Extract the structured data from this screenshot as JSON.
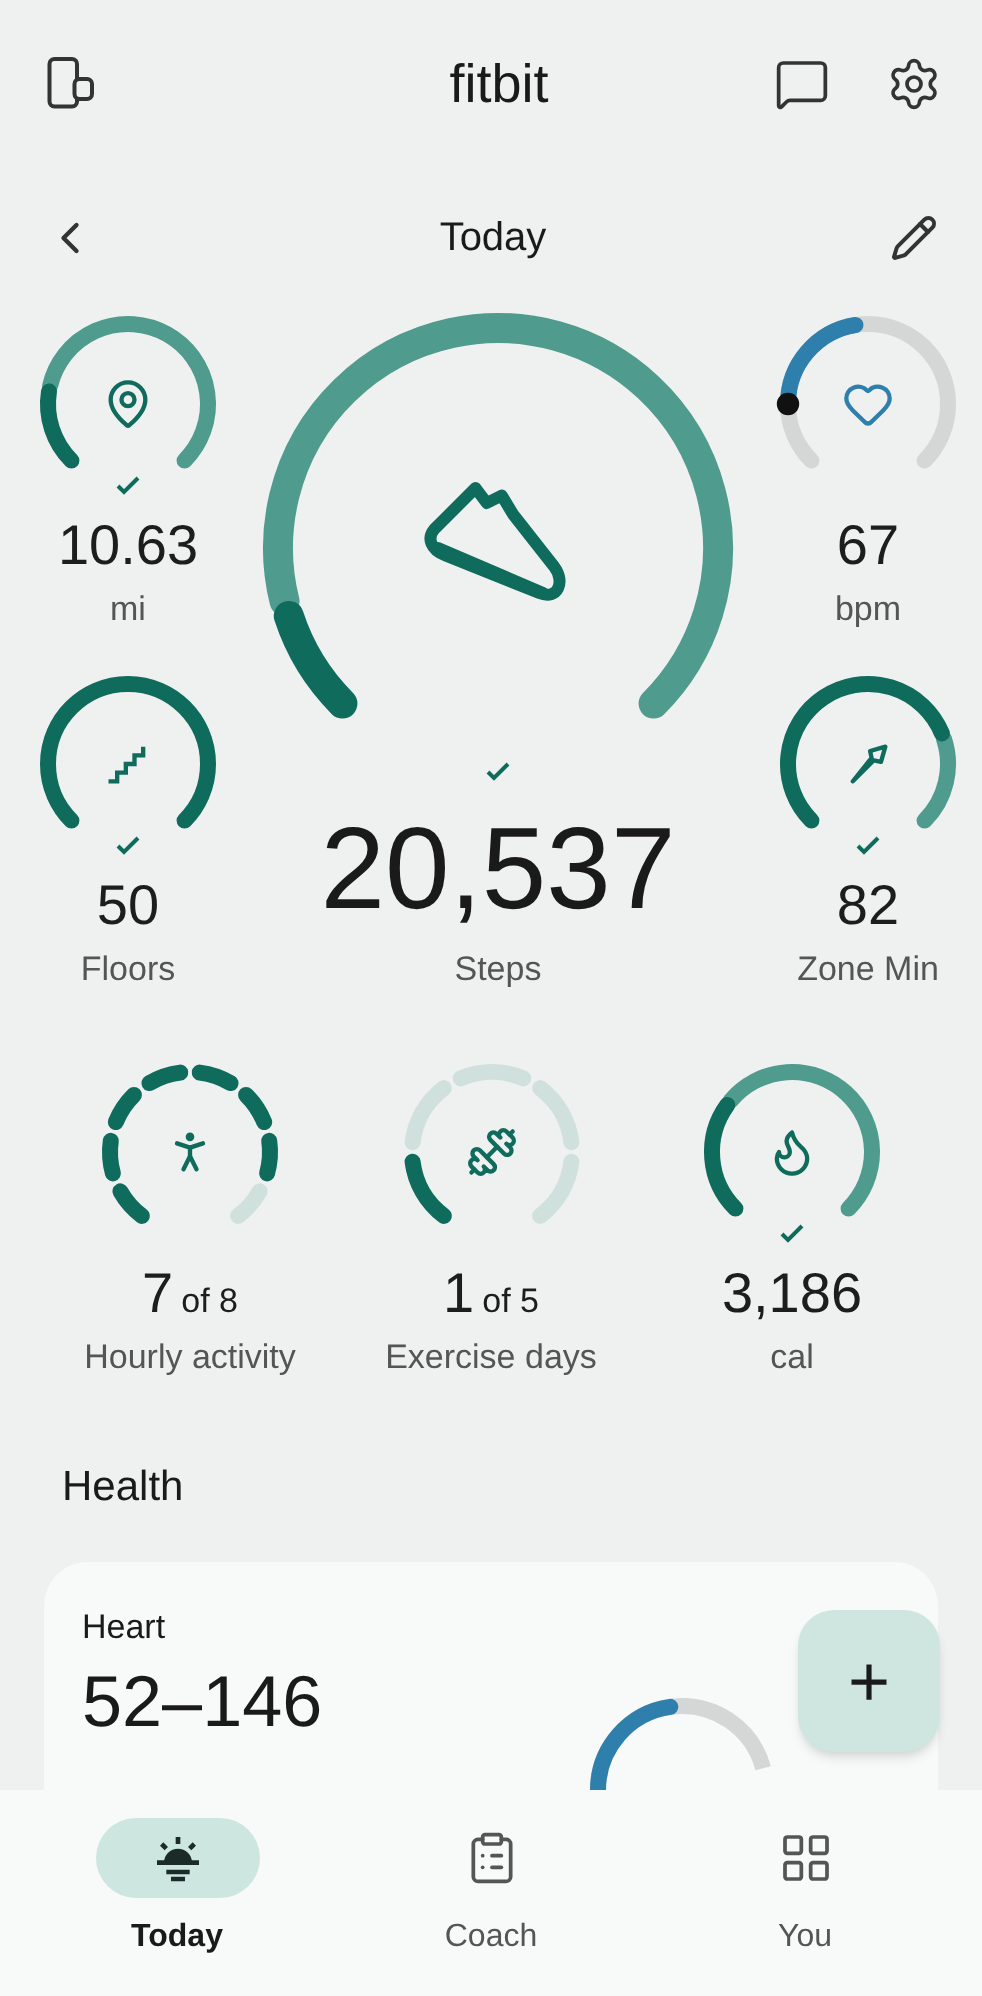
{
  "header": {
    "title": "fitbit"
  },
  "date_bar": {
    "label": "Today"
  },
  "stats": {
    "left": [
      {
        "kind": "arc",
        "value": "10.63",
        "label": "mi",
        "goal_met": true
      },
      {
        "kind": "arc",
        "value": "50",
        "label": "Floors",
        "goal_met": true
      }
    ],
    "main": {
      "kind": "arc",
      "value": "20,537",
      "label": "Steps",
      "goal_met": true
    },
    "right": [
      {
        "kind": "heart",
        "value": "67",
        "label": "bpm",
        "goal_met": false
      },
      {
        "kind": "arc",
        "value": "82",
        "label": "Zone Min",
        "goal_met": true
      }
    ],
    "row": [
      {
        "kind": "segments",
        "value": "7",
        "suffix": "of 8",
        "label": "Hourly activity",
        "goal_met": false,
        "segments": [
          {
            "filled": true
          },
          {
            "filled": true
          },
          {
            "filled": true
          },
          {
            "filled": true
          },
          {
            "filled": true
          },
          {
            "filled": true
          },
          {
            "filled": true
          },
          {
            "filled": false
          }
        ]
      },
      {
        "kind": "segments",
        "value": "1",
        "suffix": "of 5",
        "label": "Exercise days",
        "goal_met": false,
        "segments": [
          {
            "filled": true
          },
          {
            "filled": false
          },
          {
            "filled": false
          },
          {
            "filled": false
          },
          {
            "filled": false
          }
        ]
      },
      {
        "kind": "arc",
        "value": "3,186",
        "label": "cal",
        "goal_met": true
      }
    ]
  },
  "health": {
    "title": "Health",
    "card": {
      "title": "Heart",
      "value": "52–146"
    }
  },
  "fab": {
    "label": "+"
  },
  "nav": [
    {
      "label": "Today",
      "selected": true
    },
    {
      "label": "Coach",
      "selected": false
    },
    {
      "label": "You",
      "selected": false
    }
  ]
}
